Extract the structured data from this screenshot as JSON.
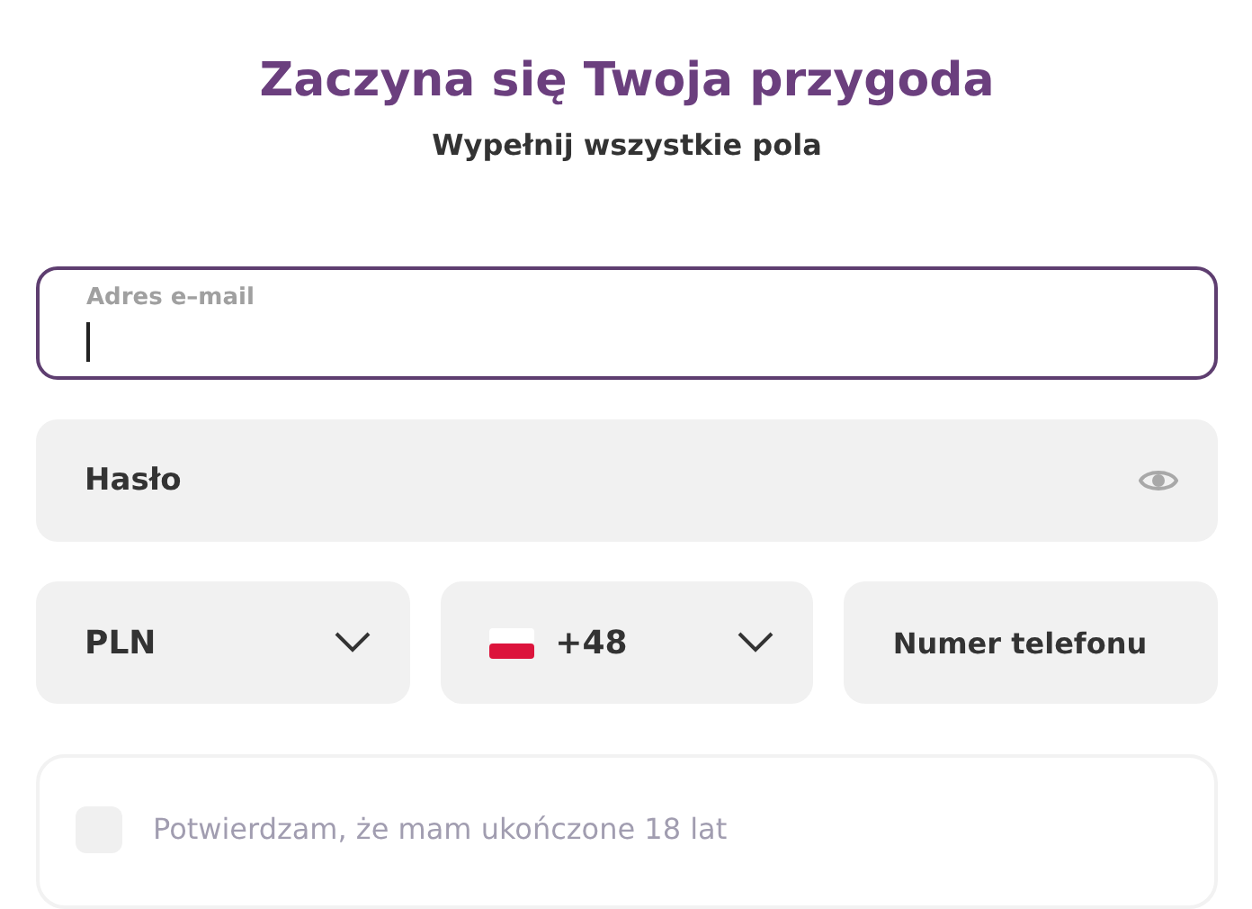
{
  "heading": "Zaczyna się Twoja przygoda",
  "subheading": "Wypełnij wszystkie pola",
  "email": {
    "label": "Adres e–mail",
    "focused": true
  },
  "password": {
    "placeholder": "Hasło"
  },
  "currency": {
    "value": "PLN"
  },
  "country_code": {
    "value": "+48"
  },
  "phone": {
    "placeholder": "Numer telefonu"
  },
  "consents": [
    {
      "label": "Potwierdzam, że mam ukończone 18 lat",
      "checked": false
    }
  ]
}
